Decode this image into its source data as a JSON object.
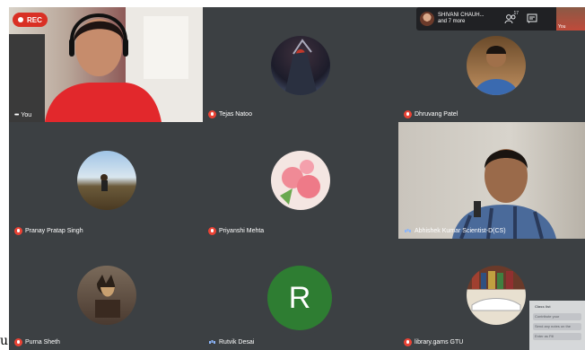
{
  "recording": {
    "label": "REC"
  },
  "top_bar": {
    "presenter_name": "SHIVANI CHAUH...",
    "more_text": "and 7 more",
    "participant_count": "17",
    "self_label": "You"
  },
  "participants": [
    {
      "name": "You"
    },
    {
      "name": "Tejas Natoo"
    },
    {
      "name": "Dhruvang Patel"
    },
    {
      "name": "Pranay Pratap Singh"
    },
    {
      "name": "Priyanshi Mehta"
    },
    {
      "name": "Abhishek Kumar Scientist-D(CS)"
    },
    {
      "name": "Purna Sheth"
    },
    {
      "name": "Rutvik Desai",
      "initial": "R"
    },
    {
      "name": "library.gams GTU"
    }
  ],
  "side_panel": {
    "title": "Class list",
    "rows": [
      "Contribute your",
      "Send any notes on the",
      "Enter as Fill"
    ]
  },
  "edge_char": "u",
  "colors": {
    "stage": "#202124",
    "tile": "#3c4043",
    "rec": "#d93025",
    "mic_off": "#ea4335",
    "avatar_green": "#2e7d32"
  }
}
